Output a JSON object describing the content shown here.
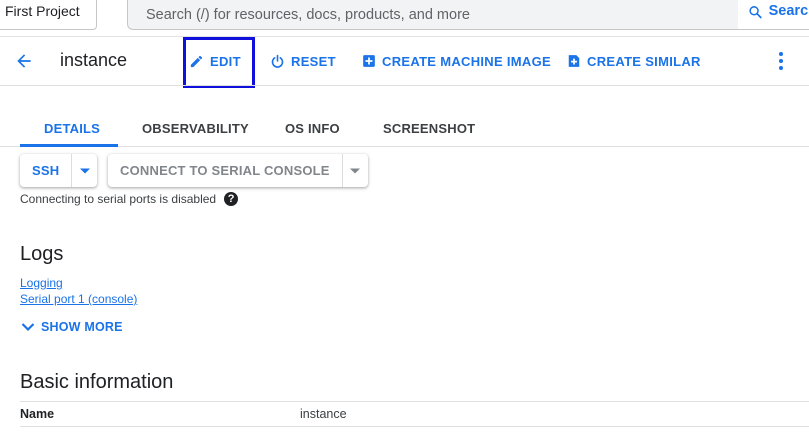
{
  "topbar": {
    "project": "First Project",
    "search_placeholder": "Search (/) for resources, docs, products, and more",
    "search_button": "Search"
  },
  "header": {
    "title": "instance",
    "actions": {
      "edit": "EDIT",
      "reset": "RESET",
      "create_machine_image": "CREATE MACHINE IMAGE",
      "create_similar": "CREATE SIMILAR"
    }
  },
  "tabs": [
    {
      "label": "DETAILS",
      "active": true
    },
    {
      "label": "OBSERVABILITY",
      "active": false
    },
    {
      "label": "OS INFO",
      "active": false
    },
    {
      "label": "SCREENSHOT",
      "active": false
    }
  ],
  "connect": {
    "ssh_label": "SSH",
    "serial_label": "CONNECT TO SERIAL CONSOLE",
    "serial_note": "Connecting to serial ports is disabled"
  },
  "logs": {
    "title": "Logs",
    "links": [
      "Logging",
      "Serial port 1 (console)"
    ],
    "show_more": "SHOW MORE"
  },
  "basic_info": {
    "title": "Basic information",
    "rows": [
      {
        "key": "Name",
        "value": "instance"
      }
    ]
  },
  "colors": {
    "accent": "#1a73e8",
    "highlight_box": "#1010dd"
  }
}
